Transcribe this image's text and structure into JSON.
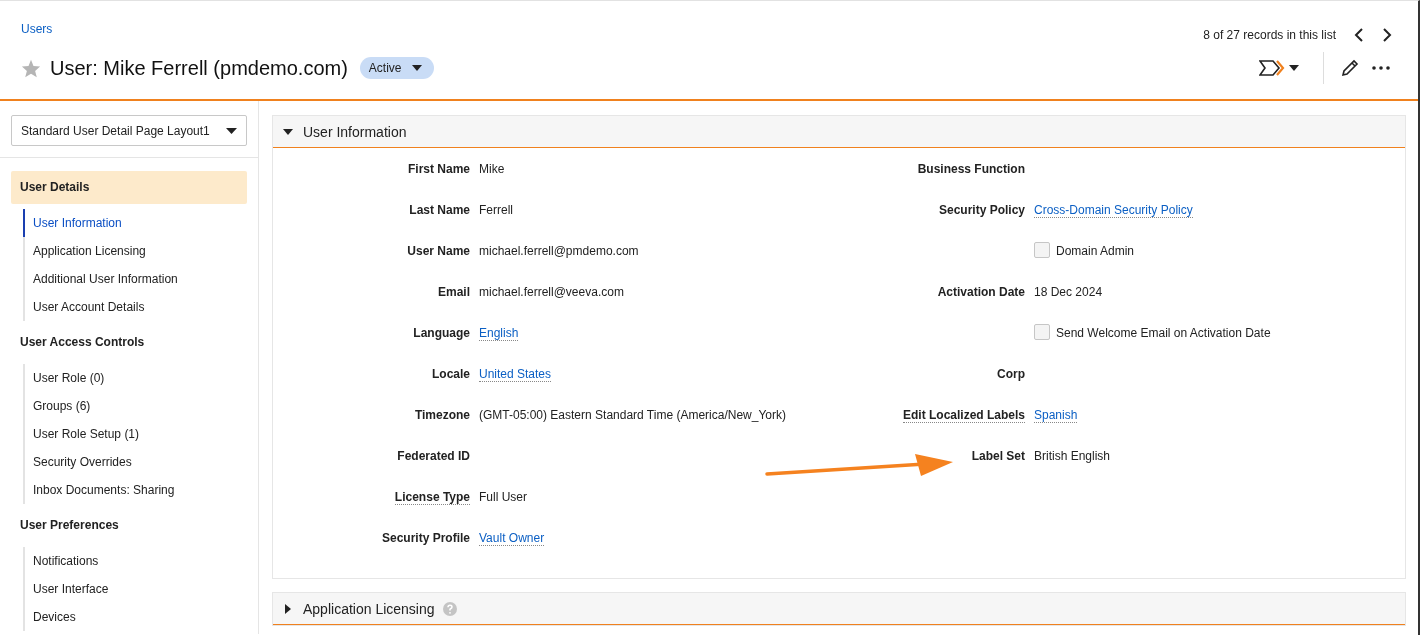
{
  "breadcrumb": "Users",
  "title": "User: Mike Ferrell (pmdemo.com)",
  "favorite": false,
  "status": "Active",
  "pager": {
    "text": "8 of 27 records in this list"
  },
  "layout_select": {
    "value": "Standard User Detail Page Layout1"
  },
  "sidebar": {
    "groups": [
      {
        "title": "User Details",
        "selected": true,
        "items": [
          {
            "label": "User Information",
            "selected": true
          },
          {
            "label": "Application Licensing",
            "selected": false
          },
          {
            "label": "Additional User Information",
            "selected": false
          },
          {
            "label": "User Account Details",
            "selected": false
          }
        ]
      },
      {
        "title": "User Access Controls",
        "selected": false,
        "items": [
          {
            "label": "User Role (0)",
            "selected": false
          },
          {
            "label": "Groups (6)",
            "selected": false
          },
          {
            "label": "User Role Setup (1)",
            "selected": false
          },
          {
            "label": "Security Overrides",
            "selected": false
          },
          {
            "label": "Inbox Documents: Sharing",
            "selected": false
          }
        ]
      },
      {
        "title": "User Preferences",
        "selected": false,
        "items": [
          {
            "label": "Notifications",
            "selected": false
          },
          {
            "label": "User Interface",
            "selected": false
          },
          {
            "label": "Devices",
            "selected": false
          }
        ]
      }
    ]
  },
  "sections": [
    {
      "title": "User Information",
      "expanded": true,
      "help": false,
      "left_fields": [
        {
          "kind": "text",
          "label": "First Name",
          "value": "Mike",
          "help_tip": false
        },
        {
          "kind": "text",
          "label": "Last Name",
          "value": "Ferrell",
          "help_tip": false
        },
        {
          "kind": "text",
          "label": "User Name",
          "value": "michael.ferrell@pmdemo.com",
          "help_tip": false
        },
        {
          "kind": "text",
          "label": "Email",
          "value": "michael.ferrell@veeva.com",
          "help_tip": false
        },
        {
          "kind": "link",
          "label": "Language",
          "value": "English",
          "help_tip": false
        },
        {
          "kind": "link",
          "label": "Locale",
          "value": "United States",
          "help_tip": false
        },
        {
          "kind": "text",
          "label": "Timezone",
          "value": "(GMT-05:00) Eastern Standard Time (America/New_York)",
          "help_tip": false
        },
        {
          "kind": "empty",
          "label": "Federated ID",
          "help_tip": false
        },
        {
          "kind": "text",
          "label": "License Type",
          "value": "Full User",
          "help_tip": true
        },
        {
          "kind": "link",
          "label": "Security Profile",
          "value": "Vault Owner",
          "help_tip": false
        }
      ],
      "right_fields": [
        {
          "kind": "empty",
          "label": "Business Function",
          "help_tip": false
        },
        {
          "kind": "link",
          "label": "Security Policy",
          "value": "Cross-Domain Security Policy",
          "help_tip": false
        },
        {
          "kind": "checkbox",
          "value": "Domain Admin",
          "checked": false
        },
        {
          "kind": "text",
          "label": "Activation Date",
          "value": "18 Dec 2024",
          "help_tip": false
        },
        {
          "kind": "checkbox",
          "value": "Send Welcome Email on Activation Date",
          "checked": false
        },
        {
          "kind": "empty",
          "label": "Corp",
          "help_tip": false
        },
        {
          "kind": "link",
          "label": "Edit Localized Labels",
          "value": "Spanish",
          "help_tip": true
        },
        {
          "kind": "text",
          "label": "Label Set",
          "value": "British English",
          "help_tip": false
        }
      ]
    },
    {
      "title": "Application Licensing",
      "expanded": false,
      "help": true
    }
  ]
}
